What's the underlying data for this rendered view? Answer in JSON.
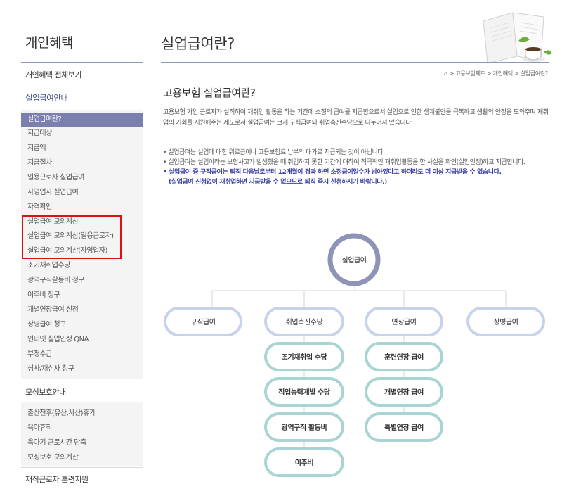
{
  "sidebar": {
    "title": "개인혜택",
    "top_items": [
      {
        "label": "개인혜택 전체보기"
      },
      {
        "label": "실업급여안내"
      }
    ],
    "unemployment_items": [
      "실업급여란?",
      "지급대상",
      "지급액",
      "지급절차",
      "일용근로자 실업급여",
      "자영업자 실업급여",
      "자격확인",
      "실업급여 모의계산",
      "실업급여 모의계산(일용근로자)",
      "실업급여 모의계산(자영업자)",
      "조기재취업수당",
      "광역구직활동비 청구",
      "이주비 청구",
      "개별연장급여 신청",
      "상병급여 청구",
      "인터넷 실업인정 QNA",
      "부정수급",
      "심사/재심사 청구"
    ],
    "maternity_title": "모성보호안내",
    "maternity_items": [
      "출산전후(유산,사산)휴가",
      "육아휴직",
      "육아기 근로시간 단축",
      "모성보호 모의계산"
    ],
    "training_title": "재직근로자 훈련지원"
  },
  "main": {
    "page_title": "실업급여란?",
    "breadcrumb": "> 고용보험제도 > 개인혜택 > 실업급여란?",
    "section_title": "고용보험 실업급여란?",
    "paragraph": "고용보험 가입 근로자가 실직하여 재취업 활동을 하는 기간에 소정의 급여를 지급함으로서 실업으로 인한 생계불안을 극복하고 생활의 안정을 도와주며 재취업의 기회를 지원해주는 제도로서 실업급여는 크게 구직급여와 취업촉진수당으로 나누어져 있습니다.",
    "bullets": [
      "실업급여는 실업에 대한 위로금이나 고용보험료 납부의 대가로 지급되는 것이 아닙니다.",
      "실업급여는 실업이라는 보험사고가 발생했을 때 취업하지 못한 기간에 대하여 적극적인 재취업활동을 한 사실을 확인(실업인정)하고 지급합니다."
    ],
    "emphasis_1": "실업급여 중 구직급여는 퇴직 다음날로부터 12개월이 경과 하면 소정급여일수가 남아있다고 하더라도 더 이상 지급받을 수 없습니다.",
    "emphasis_2": "(실업급여 신청없이 재취업하면 지급받을 수 없으므로 퇴직 즉시 신청하시기 바랍니다.)"
  },
  "diagram": {
    "root": "실업급여",
    "branches": [
      "구직급여",
      "취업촉진수당",
      "연장급여",
      "상병급여"
    ],
    "promotion_children": [
      "조기재취업 수당",
      "직업능력개발 수당",
      "광역구직 활동비",
      "이주비"
    ],
    "extension_children": [
      "훈련연장 급여",
      "개별연장 급여",
      "특별연장 급여"
    ]
  },
  "colors": {
    "accent": "#7a7fae",
    "highlight_border": "#e01010",
    "branch_border": "#c7d3ea",
    "child_border": "#a8d4d4",
    "emphasis_text": "#3b3fa3"
  }
}
